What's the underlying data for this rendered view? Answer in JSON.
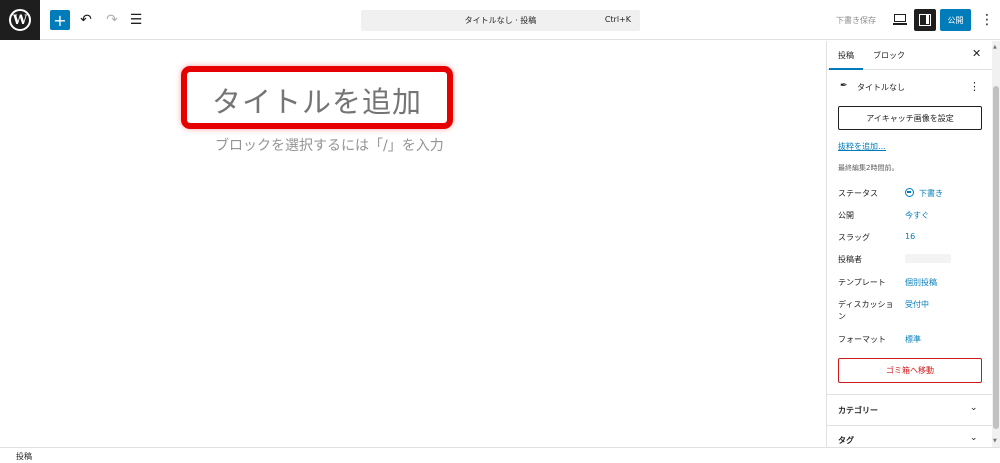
{
  "header": {
    "logo_icon": "wordpress-icon",
    "add_icon": "plus-icon",
    "undo_icon": "undo-icon",
    "redo_icon": "redo-icon",
    "list_icon": "list-view-icon",
    "command_title": "タイトルなし · 投稿",
    "command_shortcut": "Ctrl+K",
    "save_draft": "下書き保存",
    "publish": "公開",
    "accent": "#007cba"
  },
  "editor": {
    "title_placeholder": "タイトルを追加",
    "block_hint": "ブロックを選択するには「/」を入力",
    "highlight_color": "#e60000"
  },
  "sidebar": {
    "tabs": [
      "投稿",
      "ブロック"
    ],
    "post_title": "タイトルなし",
    "featured_image": "アイキャッチ画像を設定",
    "excerpt_link": "抜粋を追加…",
    "last_edited": "最終編集2時間前。",
    "rows": [
      {
        "label": "ステータス",
        "value": "下書き"
      },
      {
        "label": "公開",
        "value": "今すぐ"
      },
      {
        "label": "スラッグ",
        "value": "16"
      },
      {
        "label": "投稿者",
        "value": ""
      },
      {
        "label": "テンプレート",
        "value": "個別投稿"
      },
      {
        "label": "ディスカッション",
        "value": "受付中"
      },
      {
        "label": "フォーマット",
        "value": "標準"
      }
    ],
    "trash": "ゴミ箱へ移動",
    "panels": [
      "カテゴリー",
      "タグ"
    ],
    "danger_color": "#cc1818"
  },
  "footer": {
    "breadcrumb": "投稿"
  }
}
